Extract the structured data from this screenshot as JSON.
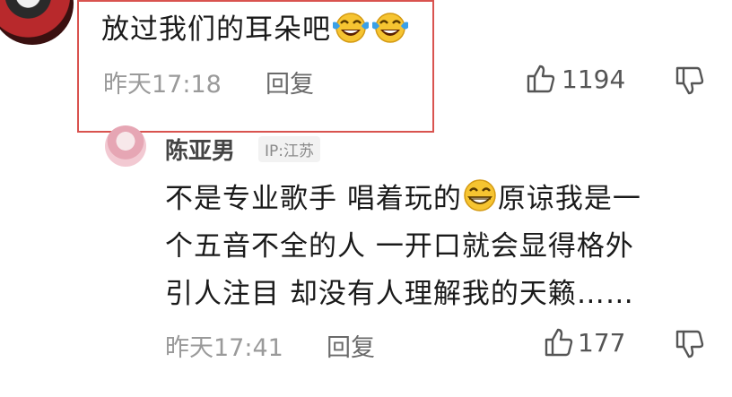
{
  "top_comment": {
    "text": "放过我们的耳朵吧",
    "emojis": [
      "laughing-tears-emoji",
      "laughing-tears-emoji"
    ],
    "time": "昨天17:18",
    "reply_label": "回复",
    "likes": "1194"
  },
  "reply_comment": {
    "username": "陈亚男",
    "ip": "IP:江苏",
    "line1_a": "不是专业歌手 唱着玩的",
    "line1_b": "原谅我是一",
    "line2": "个五音不全的人 一开口就会显得格外",
    "line3": "引人注目 却没有人理解我的天籁……",
    "time": "昨天17:41",
    "reply_label": "回复",
    "likes": "177"
  },
  "colors": {
    "highlight_border": "#d9534f",
    "emoji_yellow": "#f6c431",
    "tear_blue": "#3aa0e8"
  }
}
